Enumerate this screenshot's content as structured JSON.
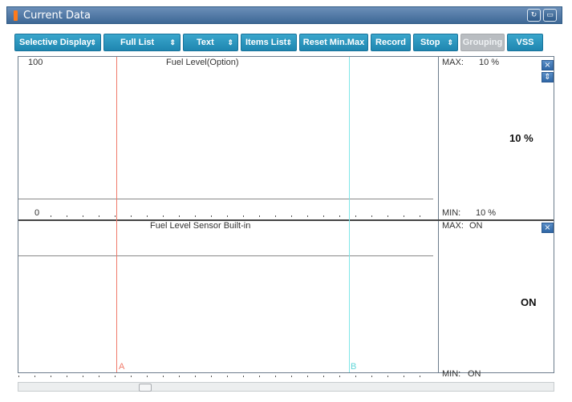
{
  "window": {
    "title": "Current Data"
  },
  "toolbar": {
    "selective_display": "Selective Display",
    "full_list": "Full List",
    "text": "Text",
    "items_list": "Items List",
    "reset_min_max": "Reset Min.Max",
    "record": "Record",
    "stop": "Stop",
    "grouping": "Grouping",
    "vss": "VSS",
    "dropdown_arrow": "⇕"
  },
  "graph1": {
    "title": "Fuel Level(Option)",
    "y_max": "100",
    "y_min": "0",
    "max_label": "MAX:",
    "max_value": "10 %",
    "min_label": "MIN:",
    "min_value": "10 %",
    "current_value": "10 %"
  },
  "graph2": {
    "title": "Fuel Level Sensor Built-in",
    "max_label": "MAX:",
    "max_value": "ON",
    "min_label": "MIN:",
    "min_value": "ON",
    "current_value": "ON"
  },
  "cursors": {
    "a": "A",
    "b": "B",
    "a_color": "#f07a6a",
    "b_color": "#7fe6e8"
  },
  "icons": {
    "close": "×",
    "expand": "⇕",
    "retry": "retry-icon",
    "restore": "restore-icon"
  },
  "colors": {
    "title_bar": "#3e6896",
    "button": "#2a95bf",
    "button_disabled": "#b9bdc1"
  }
}
